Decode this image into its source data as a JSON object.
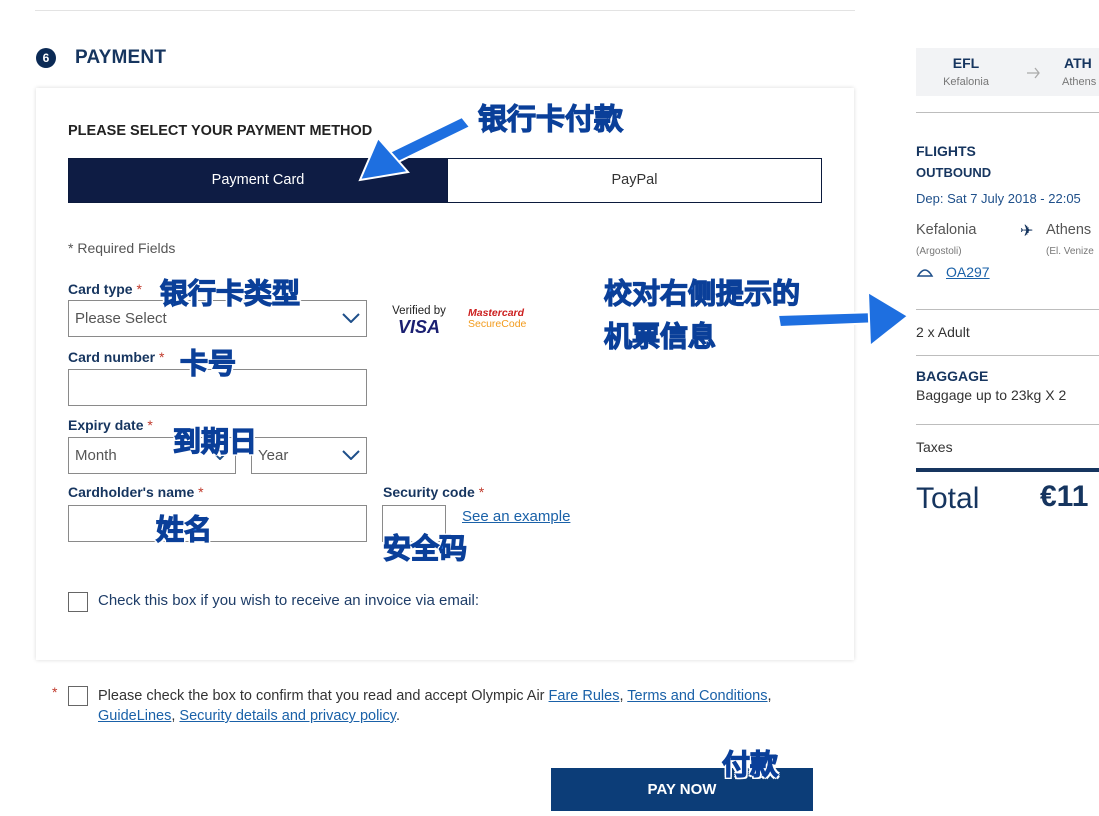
{
  "section": {
    "number": "6",
    "title": "PAYMENT"
  },
  "payment": {
    "heading": "PLEASE SELECT YOUR PAYMENT METHOD",
    "tabs": [
      "Payment Card",
      "PayPal"
    ],
    "required_note": "* Required Fields",
    "card_type_label": "Card type",
    "card_type_value": "Please Select",
    "card_number_label": "Card number",
    "expiry_label": "Expiry date",
    "month_value": "Month",
    "year_value": "Year",
    "cardholder_label": "Cardholder's name",
    "security_label": "Security code",
    "see_example": "See an example",
    "required_star": "*",
    "invoice_text": "Check this box if you wish to receive an invoice via email:",
    "verified_line1": "Verified by",
    "verified_line2": "VISA",
    "mastercard_line1": "Mastercard",
    "mastercard_line2": "SecureCode"
  },
  "terms": {
    "star": "*",
    "prefix": "Please check the box to confirm that you read and accept Olympic Air ",
    "fare_rules": "Fare Rules",
    "sep1": ", ",
    "terms_conditions": "Terms and Conditions",
    "sep2": ",",
    "guidelines": "GuideLines",
    "sep3": ", ",
    "security_privacy": "Security details and privacy policy",
    "end": "."
  },
  "pay_button": "PAY NOW",
  "summary": {
    "from_code": "EFL",
    "from_city": "Kefalonia",
    "to_code": "ATH",
    "to_city": "Athens",
    "flights": "FLIGHTS",
    "outbound": "OUTBOUND",
    "departure": "Dep: Sat 7 July 2018 - 22:05",
    "origin": "Kefalonia",
    "origin_sub": "(Argostoli)",
    "destination": "Athens",
    "destination_sub": "(El. Venize",
    "flight_number": "OA297",
    "passengers": "2 x Adult",
    "baggage_title": "BAGGAGE",
    "baggage_text": "Baggage up to 23kg X 2",
    "taxes": "Taxes",
    "total_label": "Total",
    "total_value": "€11"
  },
  "annotations": {
    "bank_card_pay": "银行卡付款",
    "card_type": "银行卡类型",
    "card_number": "卡号",
    "expiry": "到期日",
    "name": "姓名",
    "security": "安全码",
    "check_info_1": "校对右侧提示的",
    "check_info_2": "机票信息",
    "pay": "付款"
  },
  "colors": {
    "navy": "#0e1c44",
    "heading_blue": "#16355f",
    "link_blue": "#1a61a8",
    "button_blue": "#0c3d78",
    "annotation_blue": "#1e6fe0"
  }
}
